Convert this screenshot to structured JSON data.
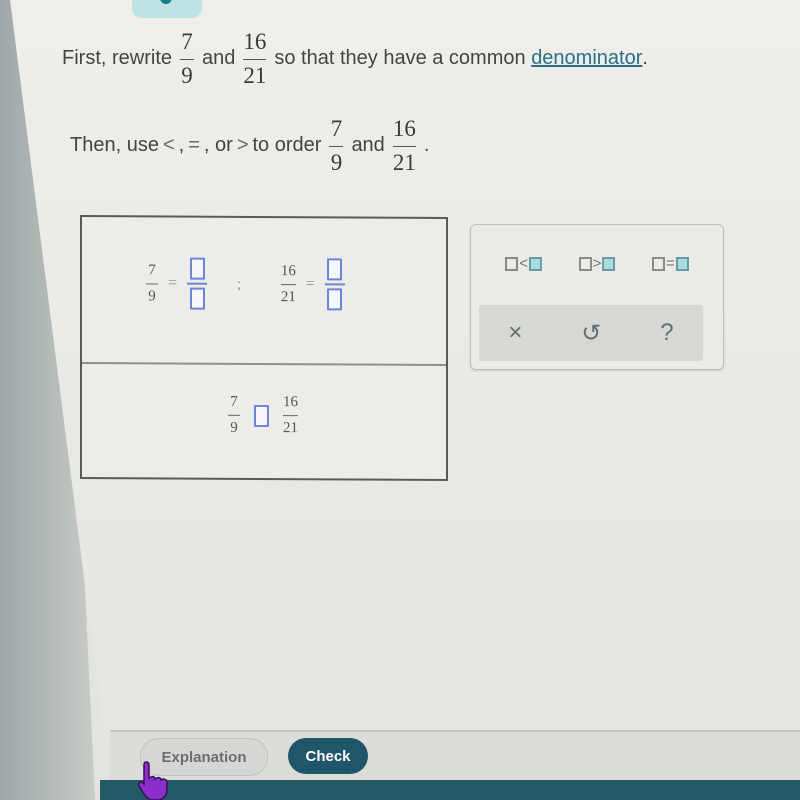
{
  "prompt": {
    "line1": {
      "before": "First, rewrite",
      "frac1": {
        "num": "7",
        "den": "9"
      },
      "mid": "and",
      "frac2": {
        "num": "16",
        "den": "21"
      },
      "after": "so that they have a common",
      "link": "denominator",
      "end": "."
    },
    "line2": {
      "before": "Then, use",
      "symbols": [
        "<",
        ",",
        "=",
        ",",
        "or",
        ">"
      ],
      "mid": "to order",
      "frac1": {
        "num": "7",
        "den": "9"
      },
      "and": "and",
      "frac2": {
        "num": "16",
        "den": "21"
      },
      "end": "."
    }
  },
  "answer": {
    "row1": {
      "left": {
        "num": "7",
        "den": "9",
        "eq": "="
      },
      "separator": ";",
      "right": {
        "num": "16",
        "den": "21",
        "eq": "="
      }
    },
    "row2": {
      "left": {
        "num": "7",
        "den": "9"
      },
      "right": {
        "num": "16",
        "den": "21"
      }
    }
  },
  "palette": {
    "ops": [
      {
        "symbol": "<",
        "name": "less-than"
      },
      {
        "symbol": ">",
        "name": "greater-than"
      },
      {
        "symbol": "=",
        "name": "equal"
      }
    ],
    "tools": {
      "clear": "×",
      "undo": "↺",
      "help": "?"
    }
  },
  "footer": {
    "explanation_label": "Explanation",
    "check_label": "Check"
  },
  "colors": {
    "accent": "#1f5669",
    "input_blue": "#6a86d8",
    "link": "#2a6f86"
  }
}
